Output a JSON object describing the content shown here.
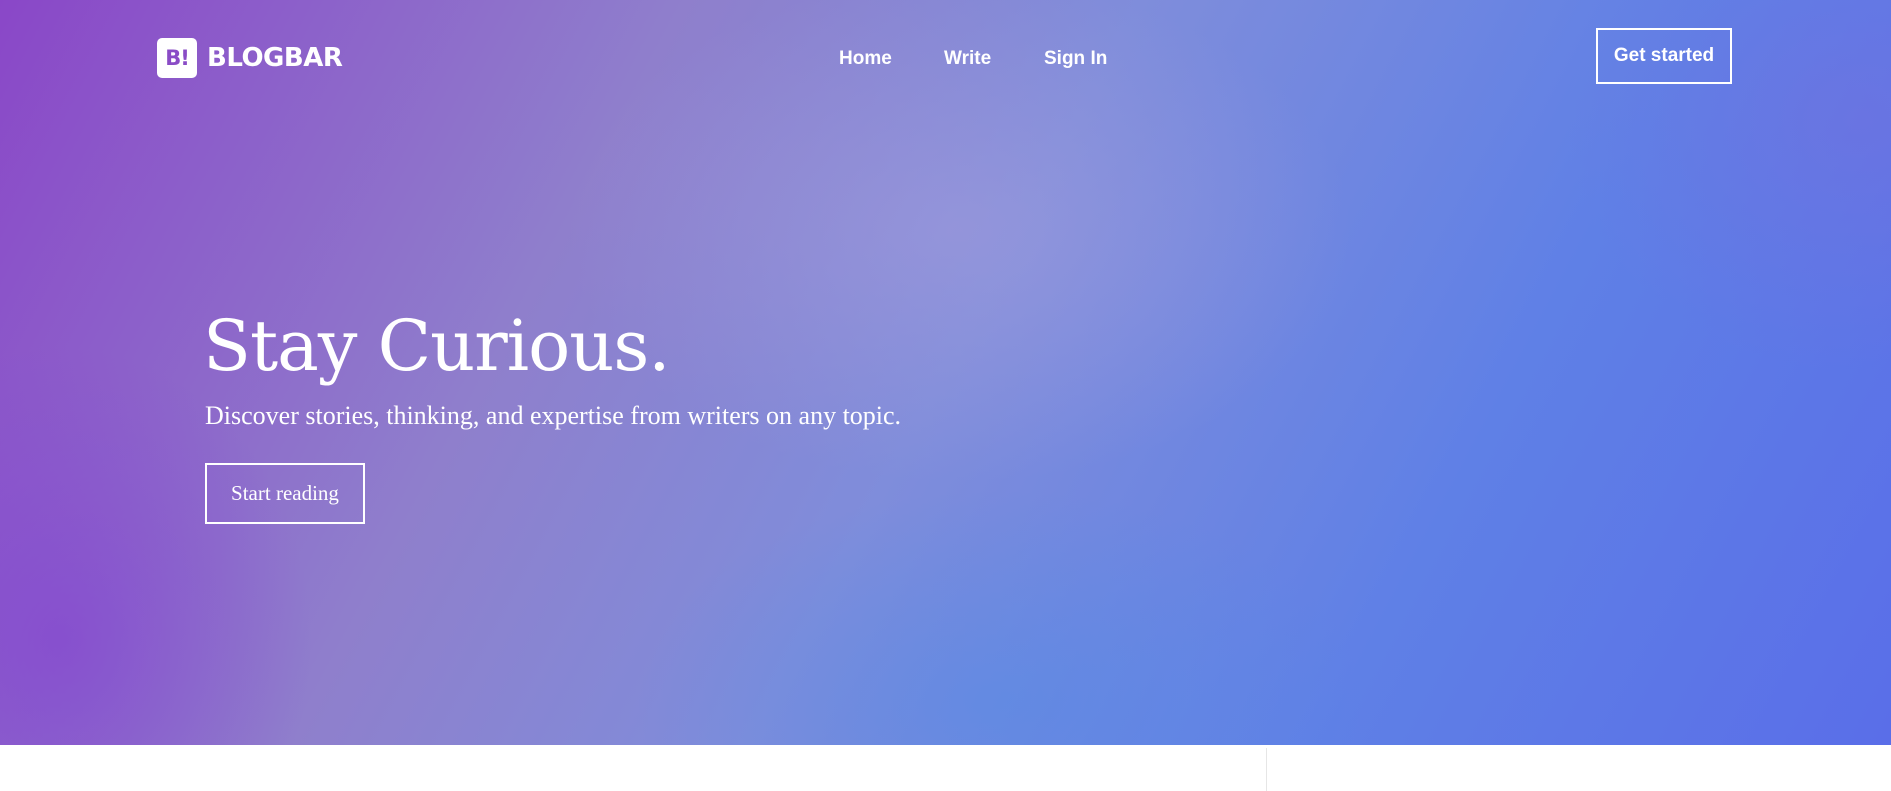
{
  "brand": {
    "mark": "B!",
    "name": "BLOGBAR",
    "icon": "logo-icon"
  },
  "nav": {
    "items": [
      {
        "label": "Home"
      },
      {
        "label": "Write"
      },
      {
        "label": "Sign In"
      }
    ],
    "cta_label": "Get started"
  },
  "hero": {
    "headline": "Stay Curious.",
    "subheadline": "Discover stories, thinking, and expertise from writers on any topic.",
    "cta_label": "Start reading"
  },
  "colors": {
    "gradient_start": "#8a47c8",
    "gradient_mid": "#7f8ddb",
    "gradient_end": "#5a6ee8",
    "text": "#ffffff",
    "page_background": "#ffffff"
  }
}
